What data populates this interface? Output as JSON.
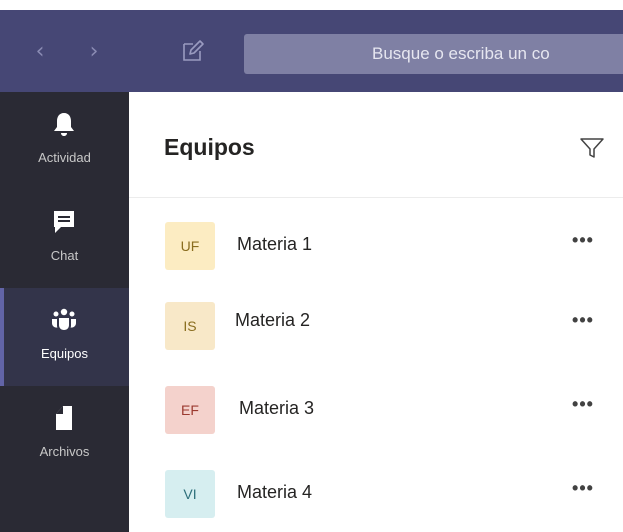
{
  "titlebar": {
    "back_icon": "chevron-left-icon",
    "forward_icon": "chevron-right-icon",
    "compose_icon": "compose-icon",
    "search": {
      "placeholder": "Busque o escriba un co",
      "value": ""
    }
  },
  "rail": {
    "items": [
      {
        "label": "Actividad",
        "icon": "bell-icon",
        "active": false
      },
      {
        "label": "Chat",
        "icon": "chat-icon",
        "active": false
      },
      {
        "label": "Equipos",
        "icon": "teams-icon",
        "active": true
      },
      {
        "label": "Archivos",
        "icon": "file-icon",
        "active": false
      }
    ]
  },
  "panel": {
    "title": "Equipos",
    "filter_icon": "filter-icon",
    "teams": [
      {
        "initials": "UF",
        "name": "Materia 1",
        "avatar_bg": "#fcecc2",
        "avatar_fg": "#8a6d1f",
        "more": "•••"
      },
      {
        "initials": "IS",
        "name": "Materia 2",
        "avatar_bg": "#f8e8c8",
        "avatar_fg": "#8a6d1f",
        "more": "•••"
      },
      {
        "initials": "EF",
        "name": "Materia 3",
        "avatar_bg": "#f4d2cc",
        "avatar_fg": "#9b3a2f",
        "more": "•••"
      },
      {
        "initials": "VI",
        "name": "Materia 4",
        "avatar_bg": "#d6eef0",
        "avatar_fg": "#2d6f7a",
        "more": "•••"
      }
    ]
  },
  "colors": {
    "titlebar_bg": "#464775",
    "search_bg": "#7f80a4",
    "rail_bg": "#2a2a34",
    "rail_active_bg": "#33344a",
    "accent": "#6264a7"
  }
}
